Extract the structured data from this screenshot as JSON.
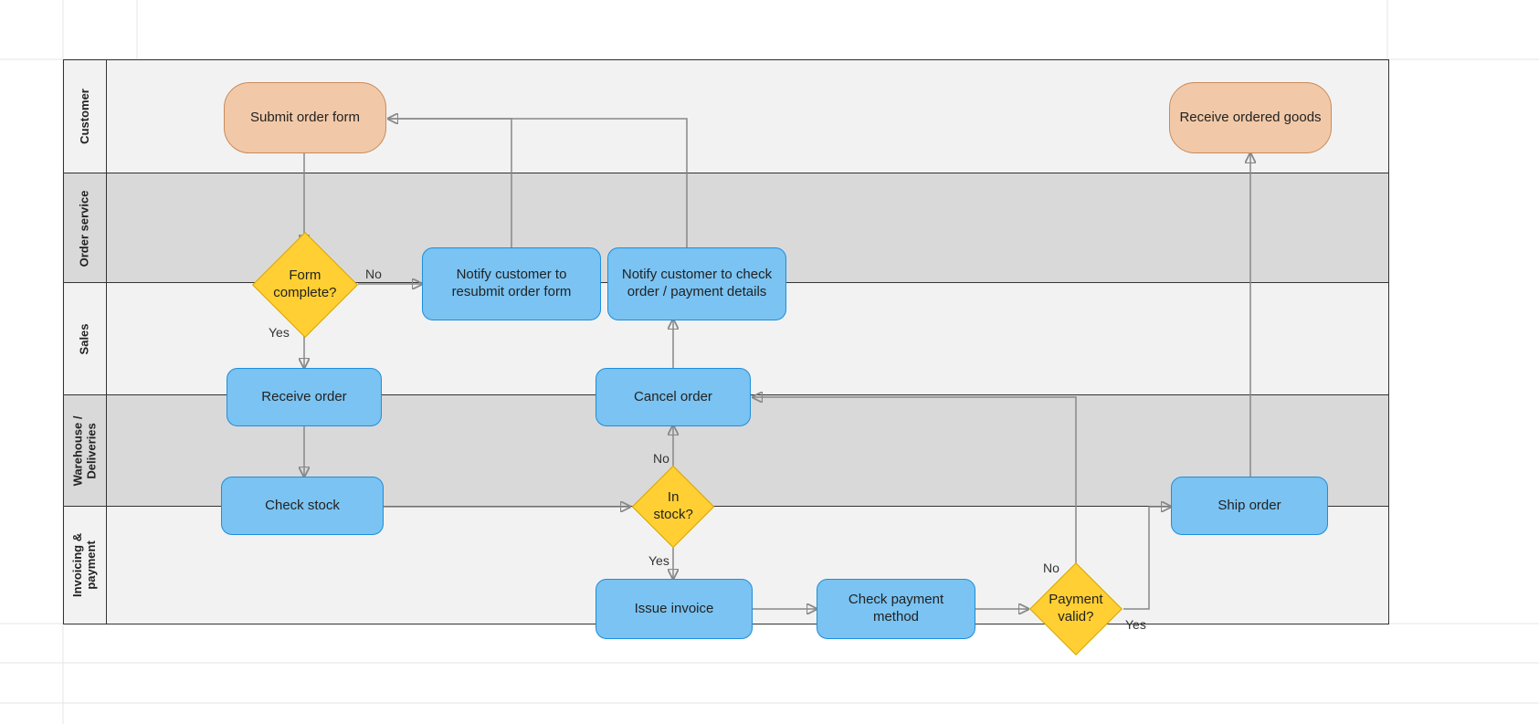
{
  "lanes": [
    {
      "name": "Customer"
    },
    {
      "name": "Order service"
    },
    {
      "name": "Sales"
    },
    {
      "name": "Warehouse /\nDeliveries"
    },
    {
      "name": "Invoicing &\npayment"
    }
  ],
  "shapes": {
    "submit_order": "Submit order form",
    "receive_goods": "Receive ordered goods",
    "form_complete": "Form complete?",
    "notify_resubmit": "Notify customer to resubmit order form",
    "notify_check": "Notify customer to check order / payment details",
    "receive_order": "Receive order",
    "cancel_order": "Cancel order",
    "check_stock": "Check stock",
    "in_stock": "In stock?",
    "ship_order": "Ship order",
    "issue_invoice": "Issue invoice",
    "check_payment": "Check payment method",
    "payment_valid": "Payment valid?"
  },
  "labels": {
    "yes": "Yes",
    "no": "No"
  }
}
